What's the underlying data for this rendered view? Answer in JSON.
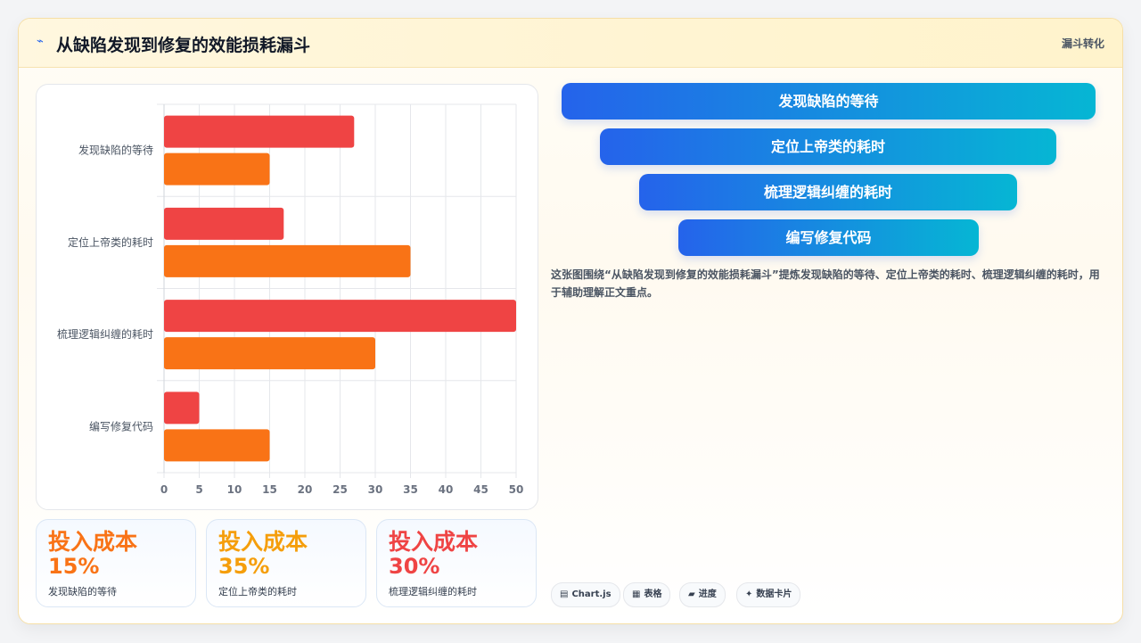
{
  "header": {
    "title": "从缺陷发现到修复的效能损耗漏斗",
    "tag": "漏斗转化",
    "icon": "lightning-icon"
  },
  "chart_data": {
    "type": "bar",
    "orientation": "horizontal",
    "categories": [
      "发现缺陷的等待",
      "定位上帝类的耗时",
      "梳理逻辑纠缠的耗时",
      "编写修复代码"
    ],
    "series": [
      {
        "color": "#ef4444",
        "values": [
          27,
          17,
          50,
          5
        ]
      },
      {
        "color": "#f97316",
        "values": [
          15,
          35,
          30,
          15
        ]
      }
    ],
    "xlim": [
      0,
      50
    ],
    "xticks": [
      0,
      5,
      10,
      15,
      20,
      25,
      30,
      35,
      40,
      45,
      50
    ],
    "grid": true
  },
  "stats": [
    {
      "title": "投入成本",
      "value": "15%",
      "label": "发现缺陷的等待",
      "color": "#f97316"
    },
    {
      "title": "投入成本",
      "value": "35%",
      "label": "定位上帝类的耗时",
      "color": "#f59e0b"
    },
    {
      "title": "投入成本",
      "value": "30%",
      "label": "梳理逻辑纠缠的耗时",
      "color": "#ef4444"
    }
  ],
  "funnel": [
    "发现缺陷的等待",
    "定位上帝类的耗时",
    "梳理逻辑纠缠的耗时",
    "编写修复代码"
  ],
  "description": "这张图围绕“从缺陷发现到修复的效能损耗漏斗”提炼发现缺陷的等待、定位上帝类的耗时、梳理逻辑纠缠的耗时，用于辅助理解正文重点。",
  "chips": [
    {
      "icon": "chart-icon",
      "label": "Chart.js"
    },
    {
      "icon": "table-icon",
      "label": "表格"
    },
    {
      "icon": "progress-icon",
      "label": "进度"
    },
    {
      "icon": "sparkle-icon",
      "label": "数据卡片"
    }
  ]
}
